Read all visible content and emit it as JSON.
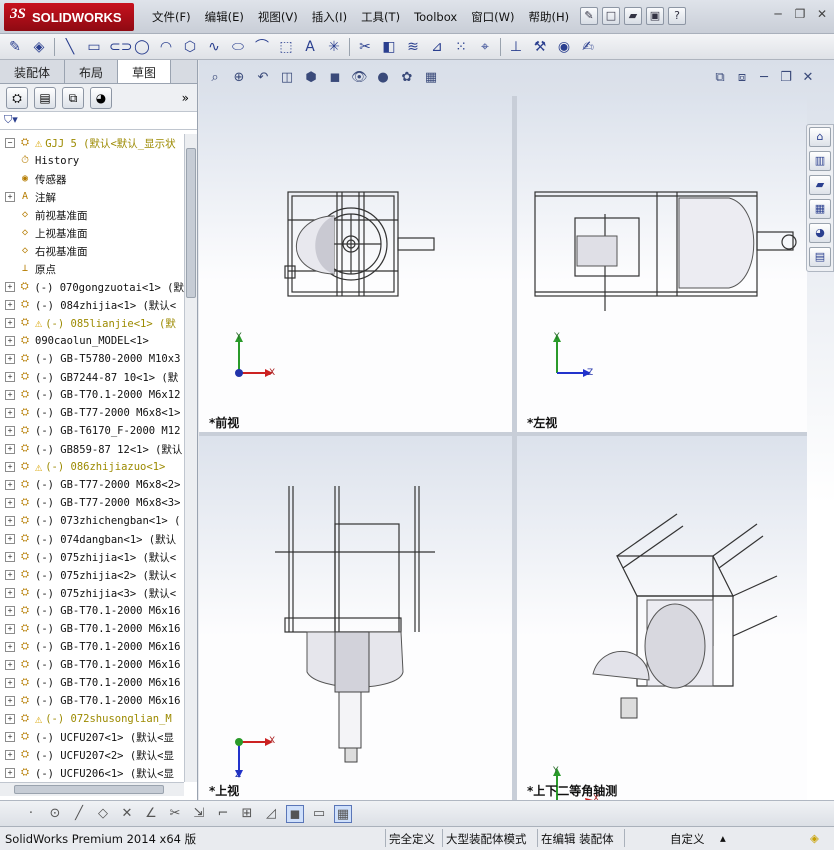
{
  "app": {
    "logo_prefix": "3S",
    "logo_text": "SOLIDWORKS"
  },
  "menu": [
    "文件(F)",
    "编辑(E)",
    "视图(V)",
    "插入(I)",
    "工具(T)",
    "Toolbox",
    "窗口(W)",
    "帮助(H)"
  ],
  "panel_tabs": [
    "装配体",
    "布局",
    "草图"
  ],
  "tree_items": [
    {
      "label": "GJJ 5  (默认<默认_显示状",
      "icon": "assembly-icon",
      "warn": true,
      "yellow": true,
      "expand": "−"
    },
    {
      "label": "History",
      "icon": "history-icon",
      "warn": false,
      "yellow": false,
      "expand": ""
    },
    {
      "label": "传感器",
      "icon": "sensor-icon",
      "warn": false,
      "yellow": false,
      "expand": ""
    },
    {
      "label": "注解",
      "icon": "annotation-icon",
      "warn": false,
      "yellow": false,
      "expand": "+"
    },
    {
      "label": "前视基准面",
      "icon": "plane-icon",
      "warn": false,
      "yellow": false,
      "expand": ""
    },
    {
      "label": "上视基准面",
      "icon": "plane-icon",
      "warn": false,
      "yellow": false,
      "expand": ""
    },
    {
      "label": "右视基准面",
      "icon": "plane-icon",
      "warn": false,
      "yellow": false,
      "expand": ""
    },
    {
      "label": "原点",
      "icon": "origin-icon",
      "warn": false,
      "yellow": false,
      "expand": ""
    },
    {
      "label": "(-) 070gongzuotai<1> (默",
      "icon": "part-icon",
      "warn": false,
      "yellow": false,
      "expand": "+"
    },
    {
      "label": "(-) 084zhijia<1> (默认<",
      "icon": "part-icon",
      "warn": false,
      "yellow": false,
      "expand": "+"
    },
    {
      "label": "(-) 085lianjie<1> (默",
      "icon": "part-icon",
      "warn": true,
      "yellow": true,
      "expand": "+"
    },
    {
      "label": "090caolun_MODEL<1>",
      "icon": "part-icon",
      "warn": false,
      "yellow": false,
      "expand": "+"
    },
    {
      "label": "(-) GB-T5780-2000 M10x3",
      "icon": "part-icon",
      "warn": false,
      "yellow": false,
      "expand": "+"
    },
    {
      "label": "(-) GB7244-87 10<1> (默",
      "icon": "part-icon",
      "warn": false,
      "yellow": false,
      "expand": "+"
    },
    {
      "label": "(-) GB-T70.1-2000 M6x12",
      "icon": "part-icon",
      "warn": false,
      "yellow": false,
      "expand": "+"
    },
    {
      "label": "(-) GB-T77-2000 M6x8<1>",
      "icon": "part-icon",
      "warn": false,
      "yellow": false,
      "expand": "+"
    },
    {
      "label": "(-) GB-T6170_F-2000 M12",
      "icon": "part-icon",
      "warn": false,
      "yellow": false,
      "expand": "+"
    },
    {
      "label": "(-) GB859-87 12<1> (默认",
      "icon": "part-icon",
      "warn": false,
      "yellow": false,
      "expand": "+"
    },
    {
      "label": "(-) 086zhijiazuo<1>",
      "icon": "part-icon",
      "warn": true,
      "yellow": true,
      "expand": "+"
    },
    {
      "label": "(-) GB-T77-2000 M6x8<2>",
      "icon": "part-icon",
      "warn": false,
      "yellow": false,
      "expand": "+"
    },
    {
      "label": "(-) GB-T77-2000 M6x8<3>",
      "icon": "part-icon",
      "warn": false,
      "yellow": false,
      "expand": "+"
    },
    {
      "label": "(-) 073zhichengban<1> (",
      "icon": "part-icon",
      "warn": false,
      "yellow": false,
      "expand": "+"
    },
    {
      "label": "(-) 074dangban<1> (默认",
      "icon": "part-icon",
      "warn": false,
      "yellow": false,
      "expand": "+"
    },
    {
      "label": "(-) 075zhijia<1> (默认<",
      "icon": "part-icon",
      "warn": false,
      "yellow": false,
      "expand": "+"
    },
    {
      "label": "(-) 075zhijia<2> (默认<",
      "icon": "part-icon",
      "warn": false,
      "yellow": false,
      "expand": "+"
    },
    {
      "label": "(-) 075zhijia<3> (默认<",
      "icon": "part-icon",
      "warn": false,
      "yellow": false,
      "expand": "+"
    },
    {
      "label": "(-) GB-T70.1-2000 M6x16",
      "icon": "part-icon",
      "warn": false,
      "yellow": false,
      "expand": "+"
    },
    {
      "label": "(-) GB-T70.1-2000 M6x16",
      "icon": "part-icon",
      "warn": false,
      "yellow": false,
      "expand": "+"
    },
    {
      "label": "(-) GB-T70.1-2000 M6x16",
      "icon": "part-icon",
      "warn": false,
      "yellow": false,
      "expand": "+"
    },
    {
      "label": "(-) GB-T70.1-2000 M6x16",
      "icon": "part-icon",
      "warn": false,
      "yellow": false,
      "expand": "+"
    },
    {
      "label": "(-) GB-T70.1-2000 M6x16",
      "icon": "part-icon",
      "warn": false,
      "yellow": false,
      "expand": "+"
    },
    {
      "label": "(-) GB-T70.1-2000 M6x16",
      "icon": "part-icon",
      "warn": false,
      "yellow": false,
      "expand": "+"
    },
    {
      "label": "(-) 072shusonglian_M",
      "icon": "part-icon",
      "warn": true,
      "yellow": true,
      "expand": "+"
    },
    {
      "label": "(-) UCFU207<1> (默认<显",
      "icon": "part-icon",
      "warn": false,
      "yellow": false,
      "expand": "+"
    },
    {
      "label": "(-) UCFU207<2> (默认<显",
      "icon": "part-icon",
      "warn": false,
      "yellow": false,
      "expand": "+"
    },
    {
      "label": "(-) UCFU206<1> (默认<显",
      "icon": "part-icon",
      "warn": false,
      "yellow": false,
      "expand": "+"
    }
  ],
  "viewports": {
    "front": "*前视",
    "left": "*左视",
    "top": "*上视",
    "iso": "*上下二等角轴测"
  },
  "triad": {
    "x": "X",
    "y": "Y",
    "z": "Z"
  },
  "status": {
    "app_version": "SolidWorks Premium 2014 x64 版",
    "defined": "完全定义",
    "mode": "大型装配体模式",
    "editing": "在编辑 装配体",
    "custom": "自定义"
  },
  "colors": {
    "brand_red": "#c8111e",
    "viewport_top": "#d9dfe9",
    "warn_yellow": "#d9a400"
  }
}
